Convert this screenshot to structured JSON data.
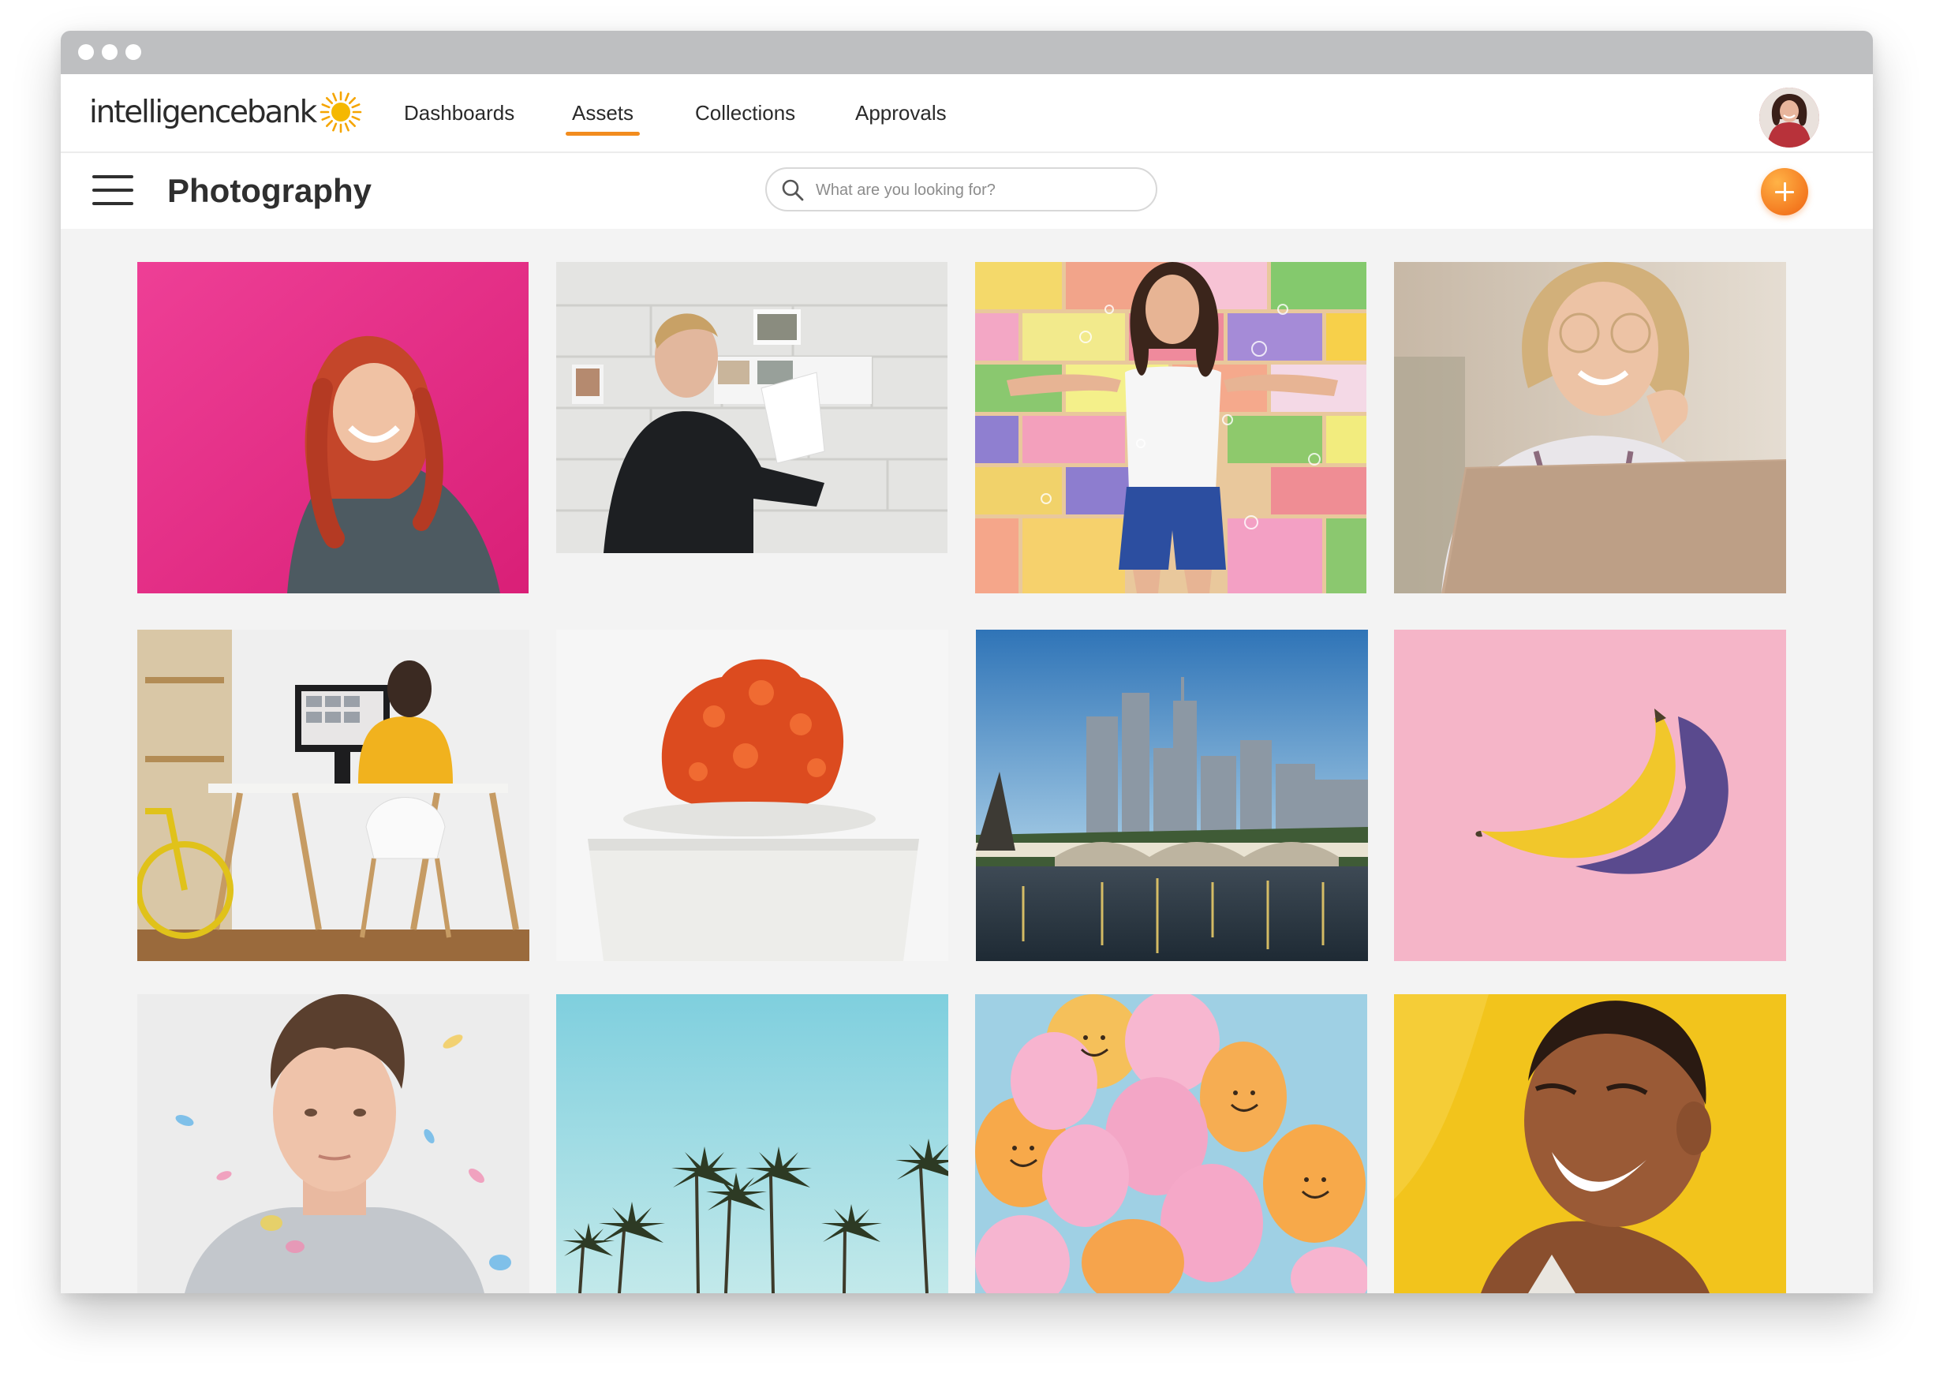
{
  "brand": {
    "name_part1": "intelligence",
    "name_part2": "bank",
    "accent": "#f28c1e",
    "sun_color": "#f5b800"
  },
  "nav": {
    "items": [
      {
        "label": "Dashboards",
        "active": false
      },
      {
        "label": "Assets",
        "active": true
      },
      {
        "label": "Collections",
        "active": false
      },
      {
        "label": "Approvals",
        "active": false
      }
    ]
  },
  "toolbar": {
    "title": "Photography",
    "search_placeholder": "What are you looking for?",
    "menu_icon": "hamburger-icon",
    "search_icon": "search-icon",
    "add_icon": "plus-icon"
  },
  "assets": [
    {
      "subject": "redhead-woman-pink-wall"
    },
    {
      "subject": "man-pinning-photos-brick-wall"
    },
    {
      "subject": "woman-bubbles-colorful-wall"
    },
    {
      "subject": "woman-glasses-laptop"
    },
    {
      "subject": "woman-desk-bicycle-office"
    },
    {
      "subject": "red-cactus-white-pot"
    },
    {
      "subject": "city-skyline-river-bridge"
    },
    {
      "subject": "banana-pink-background"
    },
    {
      "subject": "young-man-confetti"
    },
    {
      "subject": "palm-trees-blue-sky"
    },
    {
      "subject": "smiley-balloons"
    },
    {
      "subject": "laughing-woman-yellow"
    }
  ]
}
